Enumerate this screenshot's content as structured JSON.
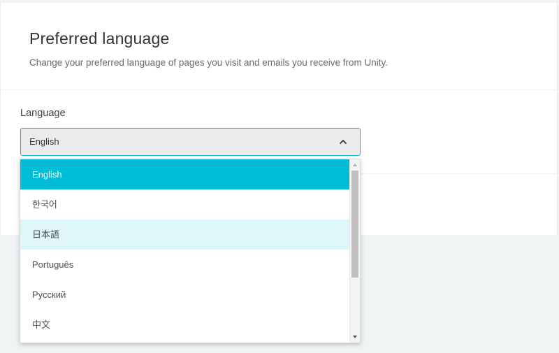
{
  "header": {
    "title": "Preferred language",
    "subtitle": "Change your preferred language of pages you visit and emails you receive from Unity."
  },
  "language_field": {
    "label": "Language",
    "selected_value": "English",
    "options": [
      {
        "label": "English",
        "state": "selected"
      },
      {
        "label": "한국어",
        "state": "normal"
      },
      {
        "label": "日本語",
        "state": "hover"
      },
      {
        "label": "Português",
        "state": "normal"
      },
      {
        "label": "Русский",
        "state": "normal"
      },
      {
        "label": "中文",
        "state": "normal"
      }
    ]
  },
  "colors": {
    "accent": "#00bcd4",
    "hover": "#def6f9",
    "select_background": "#e9ebed",
    "page_background": "#f0f4f5"
  },
  "icons": {
    "select_toggle": "chevron-up-icon",
    "scroll_up": "scroll-up-arrow-icon",
    "scroll_down": "scroll-down-arrow-icon"
  }
}
